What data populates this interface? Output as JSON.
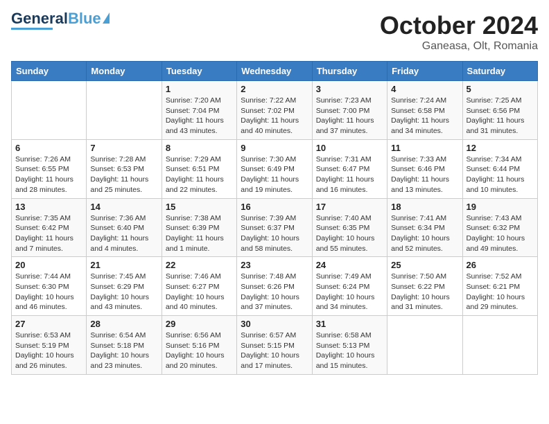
{
  "header": {
    "logo_general": "General",
    "logo_blue": "Blue",
    "month": "October 2024",
    "location": "Ganeasa, Olt, Romania"
  },
  "days_of_week": [
    "Sunday",
    "Monday",
    "Tuesday",
    "Wednesday",
    "Thursday",
    "Friday",
    "Saturday"
  ],
  "weeks": [
    [
      {
        "day": "",
        "info": ""
      },
      {
        "day": "",
        "info": ""
      },
      {
        "day": "1",
        "info": "Sunrise: 7:20 AM\nSunset: 7:04 PM\nDaylight: 11 hours and 43 minutes."
      },
      {
        "day": "2",
        "info": "Sunrise: 7:22 AM\nSunset: 7:02 PM\nDaylight: 11 hours and 40 minutes."
      },
      {
        "day": "3",
        "info": "Sunrise: 7:23 AM\nSunset: 7:00 PM\nDaylight: 11 hours and 37 minutes."
      },
      {
        "day": "4",
        "info": "Sunrise: 7:24 AM\nSunset: 6:58 PM\nDaylight: 11 hours and 34 minutes."
      },
      {
        "day": "5",
        "info": "Sunrise: 7:25 AM\nSunset: 6:56 PM\nDaylight: 11 hours and 31 minutes."
      }
    ],
    [
      {
        "day": "6",
        "info": "Sunrise: 7:26 AM\nSunset: 6:55 PM\nDaylight: 11 hours and 28 minutes."
      },
      {
        "day": "7",
        "info": "Sunrise: 7:28 AM\nSunset: 6:53 PM\nDaylight: 11 hours and 25 minutes."
      },
      {
        "day": "8",
        "info": "Sunrise: 7:29 AM\nSunset: 6:51 PM\nDaylight: 11 hours and 22 minutes."
      },
      {
        "day": "9",
        "info": "Sunrise: 7:30 AM\nSunset: 6:49 PM\nDaylight: 11 hours and 19 minutes."
      },
      {
        "day": "10",
        "info": "Sunrise: 7:31 AM\nSunset: 6:47 PM\nDaylight: 11 hours and 16 minutes."
      },
      {
        "day": "11",
        "info": "Sunrise: 7:33 AM\nSunset: 6:46 PM\nDaylight: 11 hours and 13 minutes."
      },
      {
        "day": "12",
        "info": "Sunrise: 7:34 AM\nSunset: 6:44 PM\nDaylight: 11 hours and 10 minutes."
      }
    ],
    [
      {
        "day": "13",
        "info": "Sunrise: 7:35 AM\nSunset: 6:42 PM\nDaylight: 11 hours and 7 minutes."
      },
      {
        "day": "14",
        "info": "Sunrise: 7:36 AM\nSunset: 6:40 PM\nDaylight: 11 hours and 4 minutes."
      },
      {
        "day": "15",
        "info": "Sunrise: 7:38 AM\nSunset: 6:39 PM\nDaylight: 11 hours and 1 minute."
      },
      {
        "day": "16",
        "info": "Sunrise: 7:39 AM\nSunset: 6:37 PM\nDaylight: 10 hours and 58 minutes."
      },
      {
        "day": "17",
        "info": "Sunrise: 7:40 AM\nSunset: 6:35 PM\nDaylight: 10 hours and 55 minutes."
      },
      {
        "day": "18",
        "info": "Sunrise: 7:41 AM\nSunset: 6:34 PM\nDaylight: 10 hours and 52 minutes."
      },
      {
        "day": "19",
        "info": "Sunrise: 7:43 AM\nSunset: 6:32 PM\nDaylight: 10 hours and 49 minutes."
      }
    ],
    [
      {
        "day": "20",
        "info": "Sunrise: 7:44 AM\nSunset: 6:30 PM\nDaylight: 10 hours and 46 minutes."
      },
      {
        "day": "21",
        "info": "Sunrise: 7:45 AM\nSunset: 6:29 PM\nDaylight: 10 hours and 43 minutes."
      },
      {
        "day": "22",
        "info": "Sunrise: 7:46 AM\nSunset: 6:27 PM\nDaylight: 10 hours and 40 minutes."
      },
      {
        "day": "23",
        "info": "Sunrise: 7:48 AM\nSunset: 6:26 PM\nDaylight: 10 hours and 37 minutes."
      },
      {
        "day": "24",
        "info": "Sunrise: 7:49 AM\nSunset: 6:24 PM\nDaylight: 10 hours and 34 minutes."
      },
      {
        "day": "25",
        "info": "Sunrise: 7:50 AM\nSunset: 6:22 PM\nDaylight: 10 hours and 31 minutes."
      },
      {
        "day": "26",
        "info": "Sunrise: 7:52 AM\nSunset: 6:21 PM\nDaylight: 10 hours and 29 minutes."
      }
    ],
    [
      {
        "day": "27",
        "info": "Sunrise: 6:53 AM\nSunset: 5:19 PM\nDaylight: 10 hours and 26 minutes."
      },
      {
        "day": "28",
        "info": "Sunrise: 6:54 AM\nSunset: 5:18 PM\nDaylight: 10 hours and 23 minutes."
      },
      {
        "day": "29",
        "info": "Sunrise: 6:56 AM\nSunset: 5:16 PM\nDaylight: 10 hours and 20 minutes."
      },
      {
        "day": "30",
        "info": "Sunrise: 6:57 AM\nSunset: 5:15 PM\nDaylight: 10 hours and 17 minutes."
      },
      {
        "day": "31",
        "info": "Sunrise: 6:58 AM\nSunset: 5:13 PM\nDaylight: 10 hours and 15 minutes."
      },
      {
        "day": "",
        "info": ""
      },
      {
        "day": "",
        "info": ""
      }
    ]
  ]
}
